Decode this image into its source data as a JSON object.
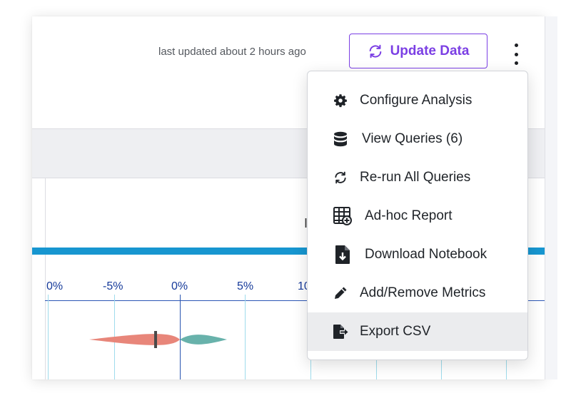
{
  "header": {
    "last_updated": "last updated about 2 hours ago",
    "update_button_label": "Update Data"
  },
  "colors": {
    "accent": "#7b3fe4",
    "bar_blue": "#1796d0",
    "axis": "#163a9a",
    "violin_negative": "#e8867a",
    "violin_positive": "#68b2ab"
  },
  "chart_axis": {
    "tick_labels": [
      "0%",
      "-5%",
      "0%",
      "5%",
      "10"
    ]
  },
  "menu": {
    "items": [
      {
        "label": "Configure Analysis",
        "icon": "gear-icon"
      },
      {
        "label": "View Queries (6)",
        "icon": "database-icon"
      },
      {
        "label": "Re-run All Queries",
        "icon": "refresh-icon"
      },
      {
        "label": "Ad-hoc Report",
        "icon": "table-add-icon"
      },
      {
        "label": "Download Notebook",
        "icon": "file-download-icon"
      },
      {
        "label": "Add/Remove Metrics",
        "icon": "pencil-icon"
      },
      {
        "label": "Export CSV",
        "icon": "file-export-icon"
      }
    ],
    "active_index": 6
  }
}
